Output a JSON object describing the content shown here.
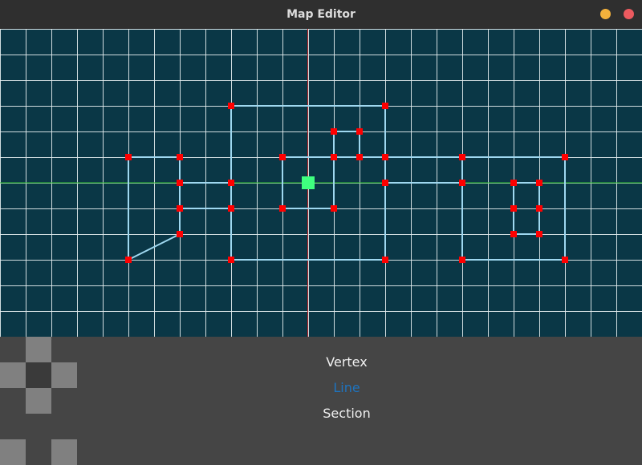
{
  "window": {
    "title": "Map Editor"
  },
  "editor": {
    "colors": {
      "background": "#0a3746",
      "grid": "#e6eef0",
      "axis_x": "#2bbf2b",
      "axis_y": "#c0242a",
      "line": "#9fd8f0",
      "vertex": "#ff0000",
      "cursor": "#3fff7f"
    }
  },
  "modes": {
    "items": [
      {
        "label": "Vertex",
        "active": false
      },
      {
        "label": "Line",
        "active": true
      },
      {
        "label": "Section",
        "active": false
      }
    ]
  },
  "palette": {
    "colors": [
      "#808080",
      "#3a3a3a"
    ]
  }
}
